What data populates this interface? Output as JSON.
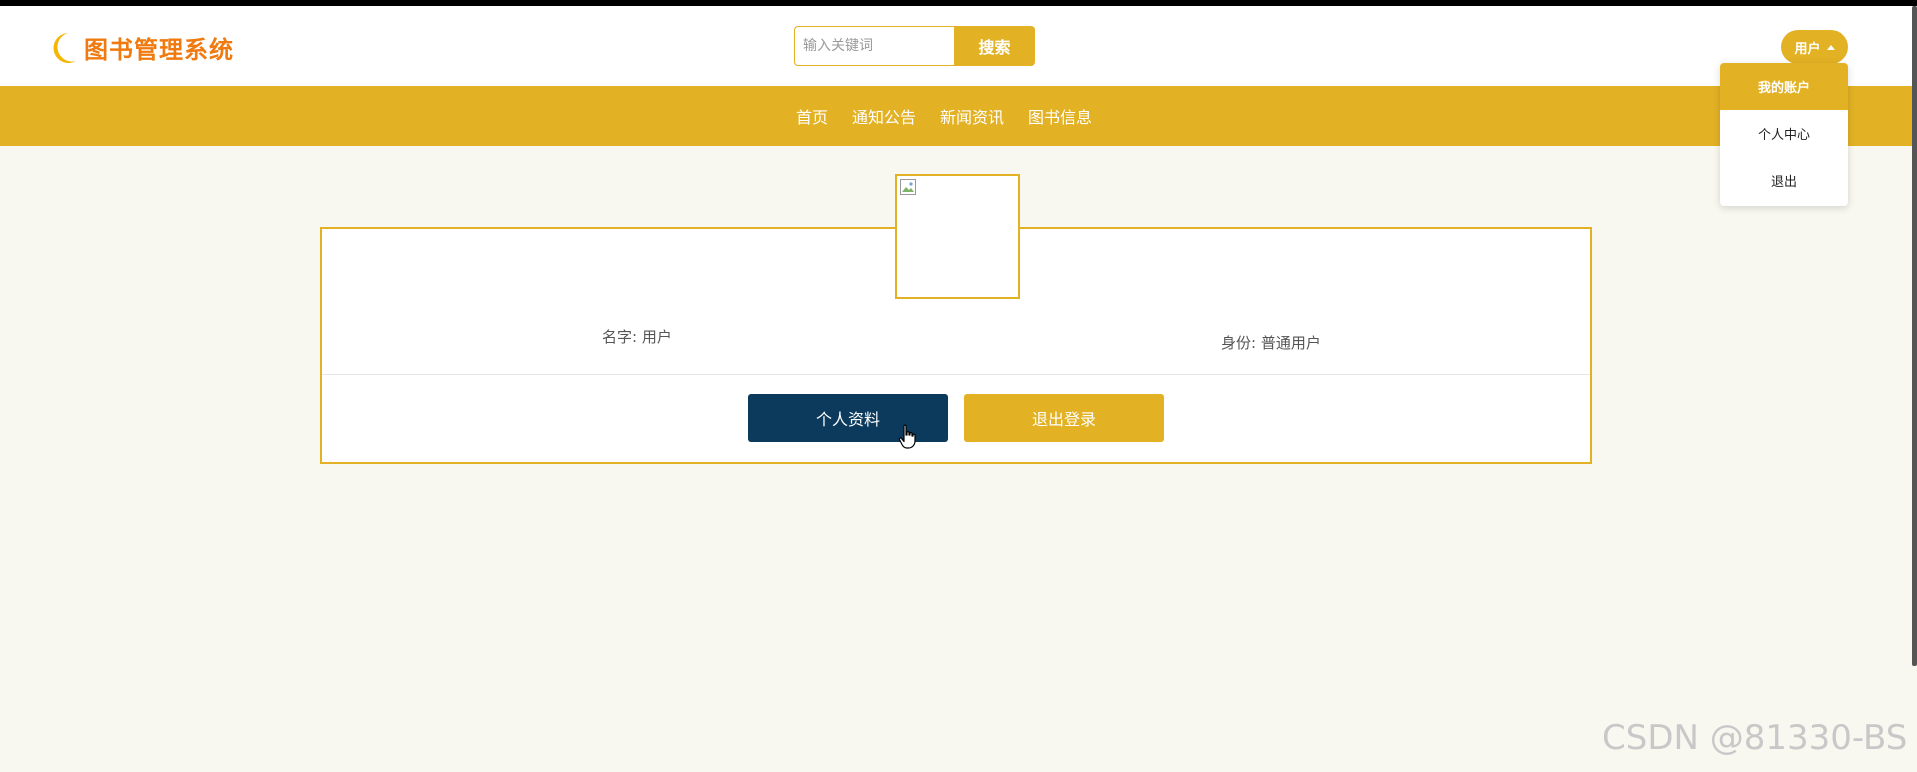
{
  "app": {
    "title": "图书管理系统"
  },
  "search": {
    "placeholder": "输入关键词",
    "value": "",
    "button_label": "搜索"
  },
  "user_menu": {
    "toggle_label": "用户",
    "items": [
      {
        "label": "我的账户",
        "active": true
      },
      {
        "label": "个人中心",
        "active": false
      },
      {
        "label": "退出",
        "active": false
      }
    ]
  },
  "nav": {
    "items": [
      {
        "label": "首页"
      },
      {
        "label": "通知公告"
      },
      {
        "label": "新闻资讯"
      },
      {
        "label": "图书信息"
      }
    ]
  },
  "profile": {
    "name_text": "名字: 用户",
    "role_text": "身份: 普通用户",
    "profile_button": "个人资料",
    "logout_button": "退出登录"
  },
  "watermark": "CSDN @81330-BS",
  "colors": {
    "accent": "#e2b124",
    "logo": "#f07a10",
    "primary_button": "#0b3a5c",
    "background": "#f8f8f0"
  },
  "icons": {
    "logo": "moon-icon",
    "dropdown": "caret-up-icon",
    "avatar": "broken-image-icon",
    "pointer": "hand-cursor-icon"
  }
}
